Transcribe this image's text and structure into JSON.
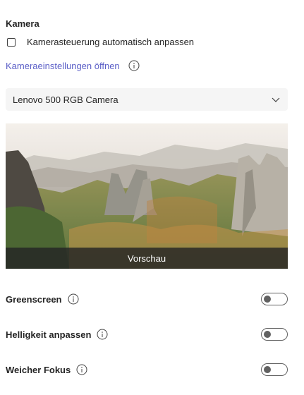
{
  "camera": {
    "title": "Kamera",
    "auto_adjust_label": "Kamerasteuerung automatisch anpassen",
    "auto_adjust_checked": false,
    "settings_link": "Kameraeinstellungen öffnen",
    "selected_camera": "Lenovo 500 RGB Camera",
    "preview_label": "Vorschau"
  },
  "toggles": [
    {
      "label": "Greenscreen",
      "on": false
    },
    {
      "label": "Helligkeit anpassen",
      "on": false
    },
    {
      "label": "Weicher Fokus",
      "on": false
    }
  ],
  "icons": {
    "info": "info-icon",
    "chevron": "chevron-down-icon"
  },
  "colors": {
    "link": "#5b5fc7",
    "text": "#242424",
    "select_bg": "#f5f5f5"
  }
}
